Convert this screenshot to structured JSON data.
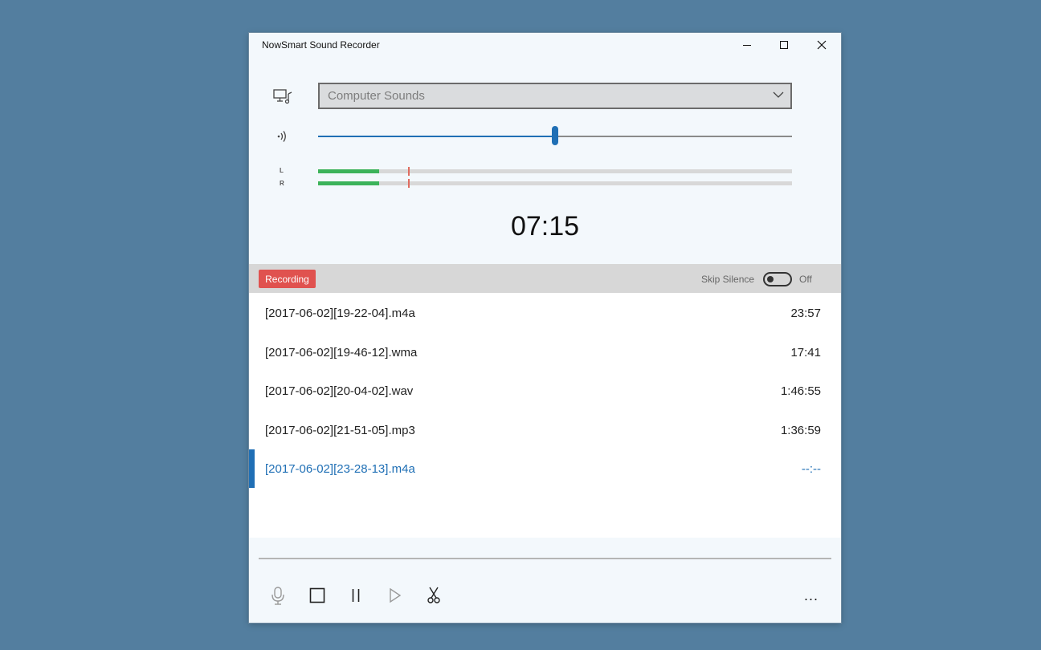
{
  "window": {
    "title": "NowSmart Sound Recorder"
  },
  "titlebar": {
    "minimize_icon": "minimize-icon",
    "maximize_icon": "maximize-icon",
    "close_icon": "close-icon"
  },
  "source": {
    "icon": "computer-sounds-icon",
    "selected": "Computer Sounds"
  },
  "volume": {
    "icon": "volume-icon",
    "level": 0.5
  },
  "meters": {
    "left_label": "L",
    "left_level": 0.128,
    "left_peak": 0.19,
    "right_label": "R",
    "right_level": 0.128,
    "right_peak": 0.19
  },
  "timer": "07:15",
  "status": {
    "badge": "Recording",
    "skip_silence_label": "Skip Silence",
    "skip_silence_state": "Off"
  },
  "recordings": [
    {
      "name": "[2017-06-02][19-22-04].m4a",
      "duration": "23:57",
      "selected": false
    },
    {
      "name": "[2017-06-02][19-46-12].wma",
      "duration": "17:41",
      "selected": false
    },
    {
      "name": "[2017-06-02][20-04-02].wav",
      "duration": "1:46:55",
      "selected": false
    },
    {
      "name": "[2017-06-02][21-51-05].mp3",
      "duration": "1:36:59",
      "selected": false
    },
    {
      "name": "[2017-06-02][23-28-13].m4a",
      "duration": "--:--",
      "selected": true
    }
  ],
  "toolbar": {
    "record_icon": "microphone-icon",
    "stop_icon": "stop-icon",
    "pause_icon": "pause-icon",
    "play_icon": "play-icon",
    "trim_icon": "scissors-icon",
    "more_label": "..."
  },
  "colors": {
    "accent": "#1f6fb5",
    "recording": "#e0524f",
    "meter": "#3cb35a",
    "peak": "#e06c60"
  }
}
